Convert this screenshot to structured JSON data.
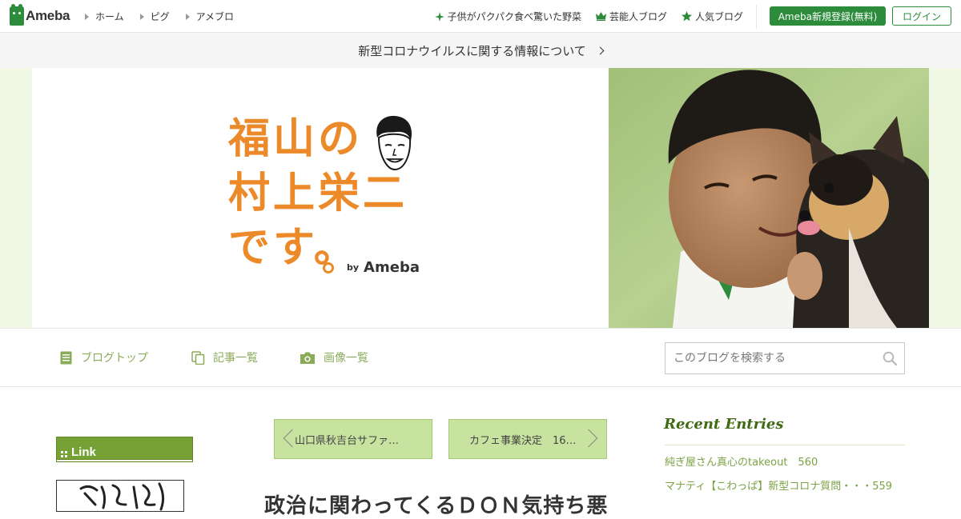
{
  "header": {
    "logo_text": "Ameba",
    "nav": [
      {
        "label": "ホーム"
      },
      {
        "label": "ピグ"
      },
      {
        "label": "アメブロ"
      }
    ],
    "links": [
      {
        "label": "子供がパクパク食べ驚いた野菜",
        "icon": "sparkle-icon"
      },
      {
        "label": "芸能人ブログ",
        "icon": "crown-icon"
      },
      {
        "label": "人気ブログ",
        "icon": "star-icon"
      }
    ],
    "register_label": "Ameba新規登録(無料)",
    "login_label": "ログイン"
  },
  "notice": {
    "text": "新型コロナウイルスに関する情報について"
  },
  "banner": {
    "title_lines": [
      "福山の",
      "村上栄二",
      "です。"
    ],
    "by_label": "by",
    "brand": "Ameba"
  },
  "blog_nav": {
    "items": [
      {
        "label": "ブログトップ",
        "icon": "document-icon"
      },
      {
        "label": "記事一覧",
        "icon": "copy-icon"
      },
      {
        "label": "画像一覧",
        "icon": "camera-icon"
      }
    ],
    "search_placeholder": "このブログを検索する"
  },
  "sidebar_left": {
    "link_heading": "Link",
    "calligraphy_text": "遠洋遊漁"
  },
  "pager": {
    "prev_label": "山口県秋吉台サファ…",
    "next_label": "カフェ事業決定　16…"
  },
  "entry": {
    "title": "政治に関わってくるＤＯＮ気持ち悪"
  },
  "sidebar_right": {
    "heading": "Recent Entries",
    "entries": [
      {
        "label": "純ぎ屋さん真心のtakeout　560"
      },
      {
        "label": "マナティ【こわっぱ】新型コロナ質問・・・559"
      }
    ]
  },
  "colors": {
    "brand_green": "#2d8c3c",
    "title_orange": "#ec8a2a",
    "accent_green": "#76a134",
    "link_green": "#7ba245"
  }
}
